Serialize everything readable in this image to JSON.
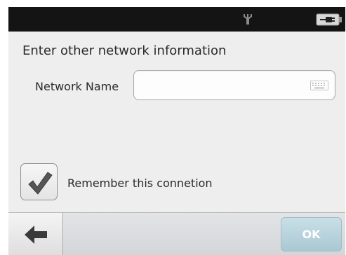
{
  "status_bar": {
    "icons": [
      "antenna-icon",
      "battery-plug-icon"
    ],
    "background": "#141414"
  },
  "dialog": {
    "title": "Enter other network information",
    "network_name_label": "Network Name",
    "network_name_value": "",
    "keyboard_icon": "keyboard-icon",
    "remember_checked": true,
    "remember_label": "Remember this connetion"
  },
  "bottom_bar": {
    "back_icon": "back-arrow-icon",
    "ok_label": "OK",
    "ok_color": "#a9c8d4"
  }
}
